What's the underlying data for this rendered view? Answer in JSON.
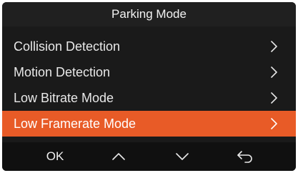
{
  "header": {
    "title": "Parking Mode"
  },
  "menu": {
    "items": [
      {
        "label": "Collision Detection",
        "icon": "chevron-right-icon",
        "selected": false
      },
      {
        "label": "Motion Detection",
        "icon": "chevron-right-icon",
        "selected": false
      },
      {
        "label": "Low Bitrate Mode",
        "icon": "chevron-right-icon",
        "selected": false
      },
      {
        "label": "Low Framerate Mode",
        "icon": "chevron-right-icon",
        "selected": true
      }
    ]
  },
  "footer": {
    "ok_label": "OK",
    "up_icon": "chevron-up-icon",
    "down_icon": "chevron-down-icon",
    "back_icon": "back-arrow-icon"
  },
  "colors": {
    "background": "#1a1a1a",
    "accent": "#e85b27",
    "text": "#e8e8e8"
  }
}
